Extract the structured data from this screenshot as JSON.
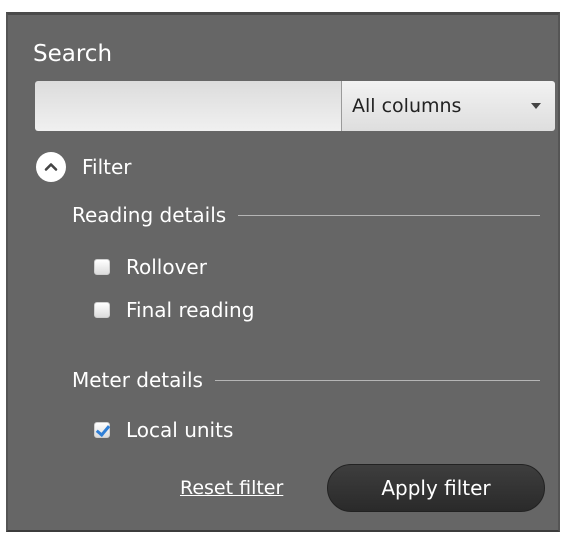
{
  "search": {
    "title": "Search",
    "input_value": "",
    "input_placeholder": "",
    "scope_selected": "All columns",
    "scope_icon": "chevron-down-icon"
  },
  "filter": {
    "toggle_label": "Filter",
    "toggle_icon": "collapse-up-icon",
    "expanded": true,
    "sections": [
      {
        "title": "Reading details",
        "options": [
          {
            "label": "Rollover",
            "checked": false
          },
          {
            "label": "Final reading",
            "checked": false
          }
        ]
      },
      {
        "title": "Meter details",
        "options": [
          {
            "label": "Local units",
            "checked": true
          }
        ]
      }
    ],
    "reset_label": "Reset filter",
    "apply_label": "Apply filter"
  },
  "colors": {
    "panel_background": "#666666",
    "checkmark": "#2f7fd6",
    "apply_button": "#333333"
  }
}
